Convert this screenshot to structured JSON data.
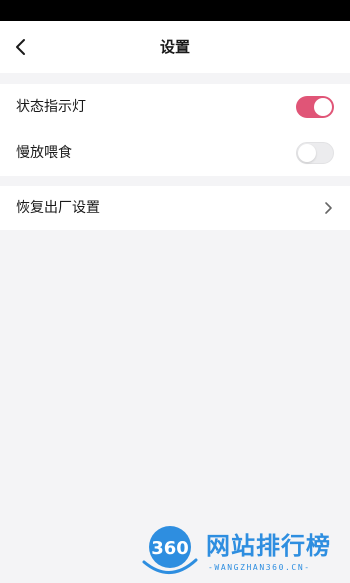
{
  "header": {
    "title": "设置"
  },
  "settings": {
    "status_light": {
      "label": "状态指示灯",
      "enabled": true
    },
    "slow_feed": {
      "label": "慢放喂食",
      "enabled": false
    },
    "factory_reset": {
      "label": "恢复出厂设置"
    }
  },
  "watermark": {
    "title": "网站排行榜",
    "url": "-WANGZHAN360.CN-",
    "logo_text": "360"
  },
  "colors": {
    "toggle_on": "#e05577",
    "toggle_off": "#ececee",
    "watermark": "#2e8ee0"
  }
}
